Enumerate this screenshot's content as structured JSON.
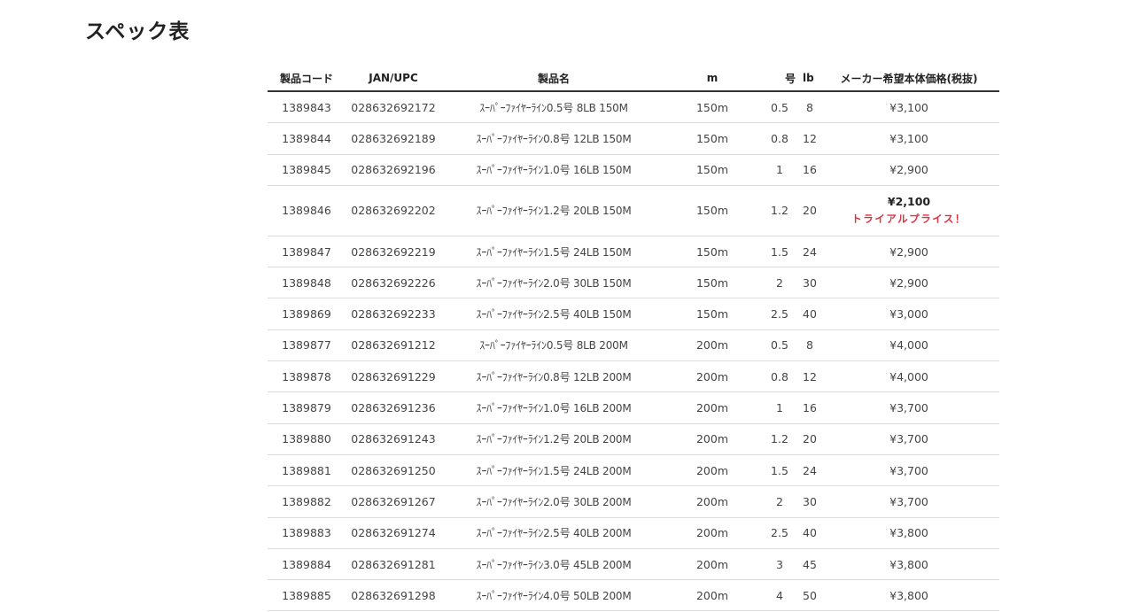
{
  "title": "スペック表",
  "headers": {
    "code": "製品コード",
    "jan": "JAN/UPC",
    "name": "製品名",
    "m": "m",
    "go": "号",
    "lb": "lb",
    "price": "メーカー希望本体価格(税抜)"
  },
  "rows": [
    {
      "code": "1389843",
      "jan": "028632692172",
      "name": "ｽｰﾊﾟｰﾌｧｲﾔｰﾗｲﾝ0.5号 8LB 150M",
      "m": "150m",
      "go": "0.5",
      "lb": "8",
      "price": "¥3,100"
    },
    {
      "code": "1389844",
      "jan": "028632692189",
      "name": "ｽｰﾊﾟｰﾌｧｲﾔｰﾗｲﾝ0.8号 12LB 150M",
      "m": "150m",
      "go": "0.8",
      "lb": "12",
      "price": "¥3,100"
    },
    {
      "code": "1389845",
      "jan": "028632692196",
      "name": "ｽｰﾊﾟｰﾌｧｲﾔｰﾗｲﾝ1.0号 16LB 150M",
      "m": "150m",
      "go": "1",
      "lb": "16",
      "price": "¥2,900"
    },
    {
      "code": "1389846",
      "jan": "028632692202",
      "name": "ｽｰﾊﾟｰﾌｧｲﾔｰﾗｲﾝ1.2号 20LB 150M",
      "m": "150m",
      "go": "1.2",
      "lb": "20",
      "price": "¥2,100",
      "note": "トライアルプライス！"
    },
    {
      "code": "1389847",
      "jan": "028632692219",
      "name": "ｽｰﾊﾟｰﾌｧｲﾔｰﾗｲﾝ1.5号 24LB 150M",
      "m": "150m",
      "go": "1.5",
      "lb": "24",
      "price": "¥2,900"
    },
    {
      "code": "1389848",
      "jan": "028632692226",
      "name": "ｽｰﾊﾟｰﾌｧｲﾔｰﾗｲﾝ2.0号 30LB 150M",
      "m": "150m",
      "go": "2",
      "lb": "30",
      "price": "¥2,900"
    },
    {
      "code": "1389869",
      "jan": "028632692233",
      "name": "ｽｰﾊﾟｰﾌｧｲﾔｰﾗｲﾝ2.5号 40LB 150M",
      "m": "150m",
      "go": "2.5",
      "lb": "40",
      "price": "¥3,000"
    },
    {
      "code": "1389877",
      "jan": "028632691212",
      "name": "ｽｰﾊﾟｰﾌｧｲﾔｰﾗｲﾝ0.5号 8LB 200M",
      "m": "200m",
      "go": "0.5",
      "lb": "8",
      "price": "¥4,000"
    },
    {
      "code": "1389878",
      "jan": "028632691229",
      "name": "ｽｰﾊﾟｰﾌｧｲﾔｰﾗｲﾝ0.8号 12LB 200M",
      "m": "200m",
      "go": "0.8",
      "lb": "12",
      "price": "¥4,000"
    },
    {
      "code": "1389879",
      "jan": "028632691236",
      "name": "ｽｰﾊﾟｰﾌｧｲﾔｰﾗｲﾝ1.0号 16LB 200M",
      "m": "200m",
      "go": "1",
      "lb": "16",
      "price": "¥3,700"
    },
    {
      "code": "1389880",
      "jan": "028632691243",
      "name": "ｽｰﾊﾟｰﾌｧｲﾔｰﾗｲﾝ1.2号 20LB 200M",
      "m": "200m",
      "go": "1.2",
      "lb": "20",
      "price": "¥3,700"
    },
    {
      "code": "1389881",
      "jan": "028632691250",
      "name": "ｽｰﾊﾟｰﾌｧｲﾔｰﾗｲﾝ1.5号 24LB 200M",
      "m": "200m",
      "go": "1.5",
      "lb": "24",
      "price": "¥3,700"
    },
    {
      "code": "1389882",
      "jan": "028632691267",
      "name": "ｽｰﾊﾟｰﾌｧｲﾔｰﾗｲﾝ2.0号 30LB 200M",
      "m": "200m",
      "go": "2",
      "lb": "30",
      "price": "¥3,700"
    },
    {
      "code": "1389883",
      "jan": "028632691274",
      "name": "ｽｰﾊﾟｰﾌｧｲﾔｰﾗｲﾝ2.5号 40LB 200M",
      "m": "200m",
      "go": "2.5",
      "lb": "40",
      "price": "¥3,800"
    },
    {
      "code": "1389884",
      "jan": "028632691281",
      "name": "ｽｰﾊﾟｰﾌｧｲﾔｰﾗｲﾝ3.0号 45LB 200M",
      "m": "200m",
      "go": "3",
      "lb": "45",
      "price": "¥3,800"
    },
    {
      "code": "1389885",
      "jan": "028632691298",
      "name": "ｽｰﾊﾟｰﾌｧｲﾔｰﾗｲﾝ4.0号 50LB 200M",
      "m": "200m",
      "go": "4",
      "lb": "50",
      "price": "¥3,800"
    }
  ]
}
